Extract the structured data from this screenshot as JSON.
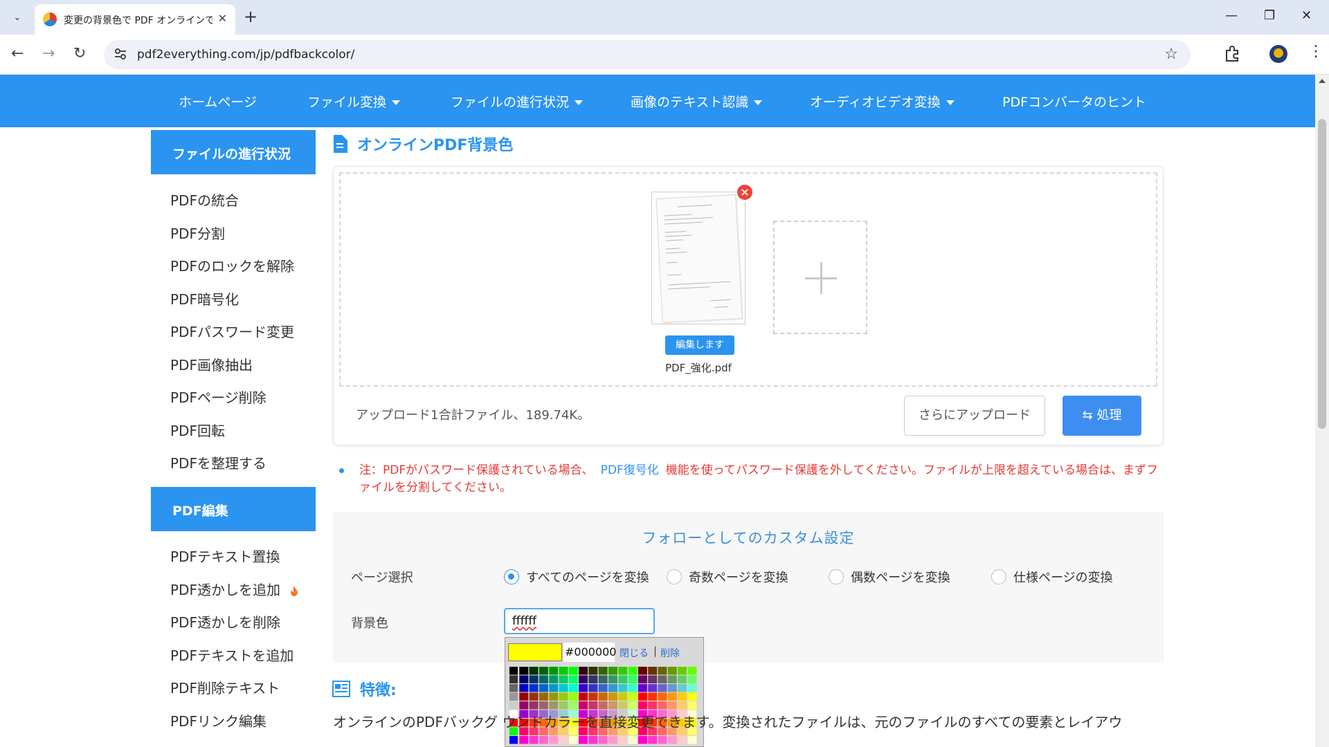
{
  "browser": {
    "tab_title": "変更の背景色で PDF オンラインで編集",
    "url": "pdf2everything.com/jp/pdfbackcolor/"
  },
  "nav": {
    "items": [
      {
        "label": "ホームページ",
        "dropdown": false
      },
      {
        "label": "ファイル変換",
        "dropdown": true
      },
      {
        "label": "ファイルの進行状況",
        "dropdown": true
      },
      {
        "label": "画像のテキスト認識",
        "dropdown": true
      },
      {
        "label": "オーディオビデオ変換",
        "dropdown": true
      },
      {
        "label": "PDFコンバータのヒント",
        "dropdown": false
      }
    ]
  },
  "sidebar": {
    "section1_title": "ファイルの進行状況",
    "section1_items": [
      "PDFの統合",
      "PDF分割",
      "PDFのロックを解除",
      "PDF暗号化",
      "PDFパスワード変更",
      "PDF画像抽出",
      "PDFページ削除",
      "PDF回転",
      "PDFを整理する"
    ],
    "section2_title": "PDF編集",
    "section2_items": [
      "PDFテキスト置換",
      "PDF透かしを追加",
      "PDF透かしを削除",
      "PDFテキストを追加",
      "PDF削除テキスト",
      "PDFリンク編集"
    ]
  },
  "main": {
    "title": "オンラインPDF背景色",
    "file": {
      "edit_label": "編集します",
      "name": "PDF_強化.pdf"
    },
    "upload_summary": "アップロード1合計ファイル、189.74K。",
    "more_upload_label": "さらにアップロード",
    "process_label": "処理",
    "note": {
      "before": "注：PDFがパスワード保護されている場合、",
      "link": "PDF復号化",
      "after": "機能を使ってパスワード保護を外してください。ファイルが上限を超えている場合は、まずファイルを分割してください。"
    },
    "settings": {
      "heading": "フォローとしてのカスタム設定",
      "page_select_label": "ページ選択",
      "options": [
        "すべてのページを変換",
        "奇数ページを変換",
        "偶数ページを変換",
        "仕様ページの変換"
      ],
      "selected_option": 0,
      "bg_color_label": "背景色",
      "bg_color_value": "ffffff"
    },
    "picker": {
      "swatch_color": "#ffff00",
      "hex_value": "#000000",
      "close_label": "閉じる",
      "separator": "|",
      "delete_label": "削除"
    },
    "features_title": "特徴:",
    "features_text": "オンラインのPDFバックグ ウンドカラーを直接変更できます。変換されたファイルは、元のファイルのすべての要素とレイアウ"
  }
}
